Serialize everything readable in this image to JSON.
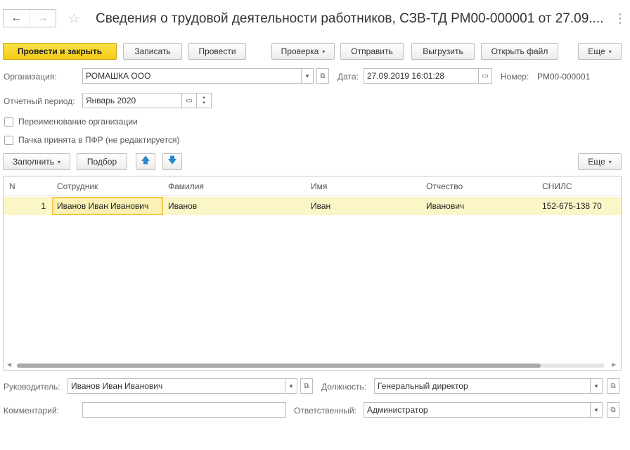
{
  "window": {
    "back_glyph": "←",
    "forward_glyph": "→",
    "star_glyph": "☆",
    "menu_glyph": "⋮",
    "title": "Сведения о трудовой деятельности работников, СЗВ-ТД РМ00-000001 от 27.09...."
  },
  "toolbar": {
    "post_close": "Провести и закрыть",
    "save": "Записать",
    "post": "Провести",
    "check": "Проверка",
    "send": "Отправить",
    "export": "Выгрузить",
    "open_file": "Открыть файл",
    "more": "Еще",
    "caret": "▾"
  },
  "header": {
    "org_label": "Организация:",
    "org_value": "РОМАШКА ООО",
    "date_label": "Дата:",
    "date_value": "27.09.2019 16:01:28",
    "number_label": "Номер:",
    "number_value": "РМ00-000001",
    "period_label": "Отчетный период:",
    "period_value": "Январь 2020",
    "rename_label": "Переименование организации",
    "pfr_label": "Пачка принята в ПФР (не редактируется)"
  },
  "table_toolbar": {
    "fill": "Заполнить",
    "pick": "Подбор",
    "up_glyph": "🡅",
    "down_glyph": "🡇",
    "more": "Еще"
  },
  "table": {
    "columns": [
      "N",
      "Сотрудник",
      "Фамилия",
      "Имя",
      "Отчество",
      "СНИЛС"
    ],
    "rows": [
      {
        "n": "1",
        "employee": "Иванов Иван Иванович",
        "last_name": "Иванов",
        "first_name": "Иван",
        "patronymic": "Иванович",
        "snils": "152-675-138 70"
      }
    ]
  },
  "footer": {
    "head_label": "Руководитель:",
    "head_value": "Иванов Иван Иванович",
    "position_label": "Должность:",
    "position_value": "Генеральный директор",
    "comment_label": "Комментарий:",
    "comment_value": "",
    "responsible_label": "Ответственный:",
    "responsible_value": "Администратор"
  },
  "colors": {
    "primary_button": "#f3cc12",
    "selected_row": "#fbf6c7",
    "selected_cell_border": "#f3c94a"
  }
}
